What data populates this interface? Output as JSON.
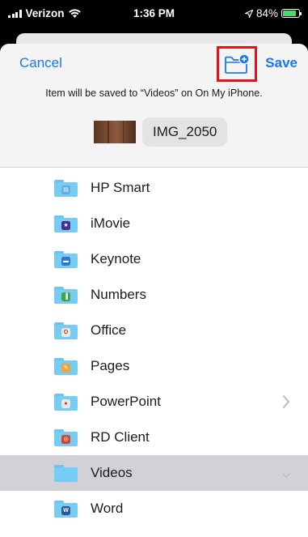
{
  "status_bar": {
    "carrier": "Verizon",
    "time": "1:36 PM",
    "battery": "84%",
    "battery_level": 0.84
  },
  "header": {
    "cancel_label": "Cancel",
    "save_label": "Save",
    "new_folder_icon": "folder-plus-icon",
    "message": "Item will be saved to “Videos” on On My iPhone.",
    "file_name": "IMG_2050"
  },
  "folders": [
    {
      "label": "HP Smart",
      "badge_color": "#5fb0dc",
      "badge_glyph": "▤",
      "chevron": false,
      "selected": false
    },
    {
      "label": "iMovie",
      "badge_color": "#4a2f8f",
      "badge_glyph": "★",
      "chevron": false,
      "selected": false
    },
    {
      "label": "Keynote",
      "badge_color": "#2f78d2",
      "badge_glyph": "▬",
      "chevron": false,
      "selected": false
    },
    {
      "label": "Numbers",
      "badge_color": "#3ba64a",
      "badge_glyph": "▐",
      "chevron": false,
      "selected": false
    },
    {
      "label": "Office",
      "badge_color": "#e8e8e8",
      "badge_glyph": "O",
      "glyph_color": "#d83b01",
      "chevron": false,
      "selected": false
    },
    {
      "label": "Pages",
      "badge_color": "#f2a33b",
      "badge_glyph": "✎",
      "chevron": false,
      "selected": false
    },
    {
      "label": "PowerPoint",
      "badge_color": "#e8e8e8",
      "badge_glyph": "●",
      "glyph_color": "#c43e1c",
      "chevron": true,
      "selected": false
    },
    {
      "label": "RD Client",
      "badge_color": "#d0462f",
      "badge_glyph": "◎",
      "chevron": false,
      "selected": false
    },
    {
      "label": "Videos",
      "badge_color": "",
      "badge_glyph": "",
      "chevron": true,
      "chevron_down": true,
      "selected": true
    },
    {
      "label": "Word",
      "badge_color": "#2b579a",
      "badge_glyph": "W",
      "chevron": false,
      "selected": false
    }
  ],
  "colors": {
    "accent": "#1877f2",
    "highlight_box": "#e3121b",
    "selected_row": "#d2d2d6"
  }
}
